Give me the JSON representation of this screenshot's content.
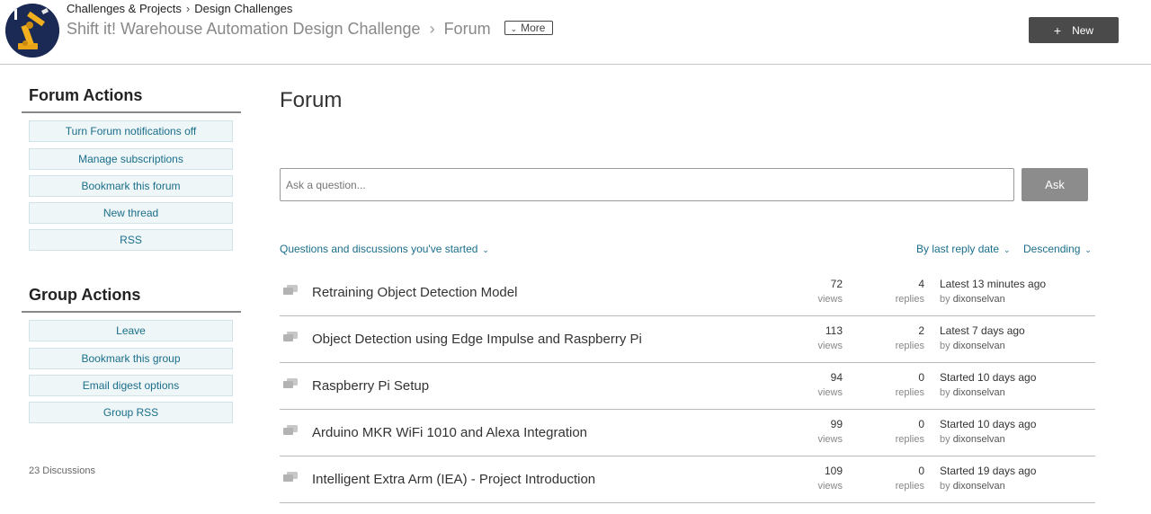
{
  "header": {
    "breadcrumbs": [
      "Challenges & Projects",
      "Design Challenges"
    ],
    "group_title": "Shift it! Warehouse Automation Design Challenge",
    "section": "Forum",
    "more_label": "More",
    "new_label": "New"
  },
  "sidebar": {
    "forum_actions_title": "Forum Actions",
    "forum_actions": [
      "Turn Forum notifications off",
      "Manage subscriptions",
      "Bookmark this forum",
      "New thread",
      "RSS"
    ],
    "group_actions_title": "Group Actions",
    "group_actions": [
      "Leave",
      "Bookmark this group",
      "Email digest options",
      "Group RSS"
    ],
    "discussion_count": "23 Discussions"
  },
  "main": {
    "title": "Forum",
    "ask_placeholder": "Ask a question...",
    "ask_button": "Ask",
    "filter_label": "Questions and discussions you've started",
    "sort_label": "By last reply date",
    "order_label": "Descending",
    "threads": [
      {
        "title": "Retraining Object Detection Model",
        "views": "72",
        "views_label": "views",
        "replies": "4",
        "replies_label": "replies",
        "latest": "Latest 13 minutes ago",
        "by": "by",
        "author": "dixonselvan"
      },
      {
        "title": "Object Detection using Edge Impulse and Raspberry Pi",
        "views": "113",
        "views_label": "views",
        "replies": "2",
        "replies_label": "replies",
        "latest": "Latest 7 days ago",
        "by": "by",
        "author": "dixonselvan"
      },
      {
        "title": "Raspberry Pi Setup",
        "views": "94",
        "views_label": "views",
        "replies": "0",
        "replies_label": "replies",
        "latest": "Started 10 days ago",
        "by": "by",
        "author": "dixonselvan"
      },
      {
        "title": "Arduino MKR WiFi 1010 and Alexa Integration",
        "views": "99",
        "views_label": "views",
        "replies": "0",
        "replies_label": "replies",
        "latest": "Started 10 days ago",
        "by": "by",
        "author": "dixonselvan"
      },
      {
        "title": "Intelligent Extra Arm (IEA) - Project Introduction",
        "views": "109",
        "views_label": "views",
        "replies": "0",
        "replies_label": "replies",
        "latest": "Started 19 days ago",
        "by": "by",
        "author": "dixonselvan"
      }
    ]
  },
  "icons": {
    "thread": "discussion-bubbles-icon",
    "logo": "robot-arm-logo"
  },
  "colors": {
    "link": "#1a6e8a",
    "new_button": "#4a4a4a",
    "ask_button": "#8c8c8c",
    "action_bg": "#eef6f8"
  }
}
